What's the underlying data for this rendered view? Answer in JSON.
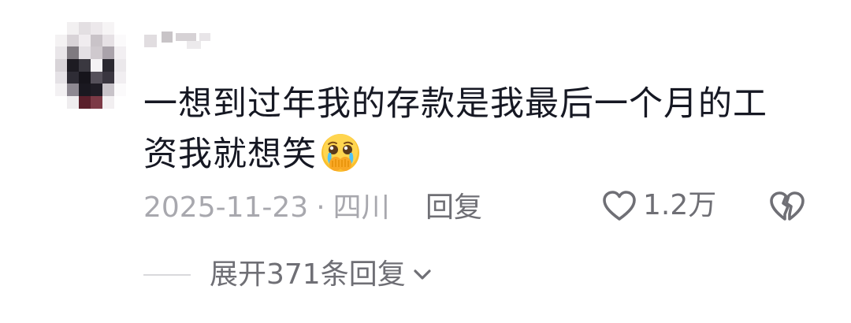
{
  "comment": {
    "username": "",
    "text_line1": "一想到过年我的存款是我最后一个月的工",
    "text_line2": "资我就想笑",
    "emoji": "crying-laughing-hands-emoji",
    "date": "2025-11-23",
    "separator": "·",
    "location": "四川",
    "reply_label": "回复",
    "like_count": "1.2万",
    "expand_label": "展开371条回复"
  },
  "icons": {
    "like": "heart-outline-icon",
    "dislike": "broken-heart-icon",
    "expand": "chevron-down-icon"
  },
  "colors": {
    "text": "#161823",
    "meta": "#a8a8ae",
    "action": "#6f6f75"
  }
}
